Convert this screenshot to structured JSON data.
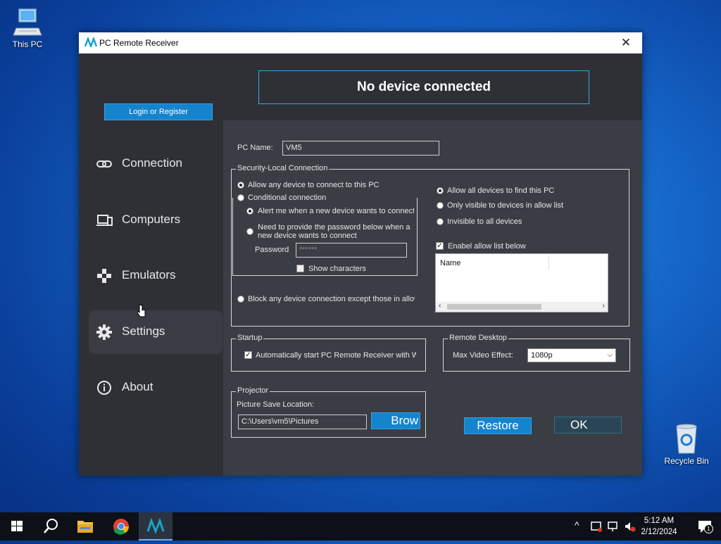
{
  "desktop": {
    "this_pc_label": "This PC",
    "recycle_bin_label": "Recycle Bin"
  },
  "window": {
    "title": "PC Remote Receiver",
    "close_glyph": "✕",
    "login_button": "Login or Register",
    "status": "No device connected",
    "nav": [
      {
        "label": "Connection",
        "icon": "link-icon"
      },
      {
        "label": "Computers",
        "icon": "computers-icon"
      },
      {
        "label": "Emulators",
        "icon": "gamepad-icon"
      },
      {
        "label": "Settings",
        "icon": "gear-icon",
        "active": true
      },
      {
        "label": "About",
        "icon": "info-icon"
      }
    ]
  },
  "settings": {
    "pc_name_label": "PC Name:",
    "pc_name_value": "VM5",
    "security": {
      "legend": "Security-Local Connection",
      "allow_any": "Allow any device to connect to this PC",
      "conditional": "Conditional connection",
      "alert_me": "Alert me when a new device wants to connect",
      "need_password": "Need to provide the password below when a new device wants to connect",
      "password_label": "Password",
      "password_value": "******",
      "show_characters": "Show characters",
      "block_any": "Block any device connection except those in allow list",
      "allow_all_find": "Allow all devices to find this PC",
      "only_visible": "Only visible to devices in allow list",
      "invisible": "Invisible to all devices",
      "enable_allow_list": "Enabel allow list below",
      "list_header": "Name"
    },
    "startup": {
      "legend": "Startup",
      "auto_start": "Automatically start PC Remote Receiver with Windows"
    },
    "remote_desktop": {
      "legend": "Remote Desktop",
      "max_video_label": "Max Video Effect:",
      "max_video_value": "1080p"
    },
    "projector": {
      "legend": "Projector",
      "save_location_label": "Picture Save Location:",
      "save_location_value": "C:\\Users\\vm5\\Pictures",
      "browse_button": "Brow"
    },
    "restore_button": "Restore",
    "ok_button": "OK"
  },
  "taskbar": {
    "time": "5:12 AM",
    "date": "2/12/2024",
    "notification_count": "1"
  },
  "colors": {
    "accent": "#1584cd",
    "window_bg": "#2e3036",
    "content_bg": "#3a3d44"
  }
}
